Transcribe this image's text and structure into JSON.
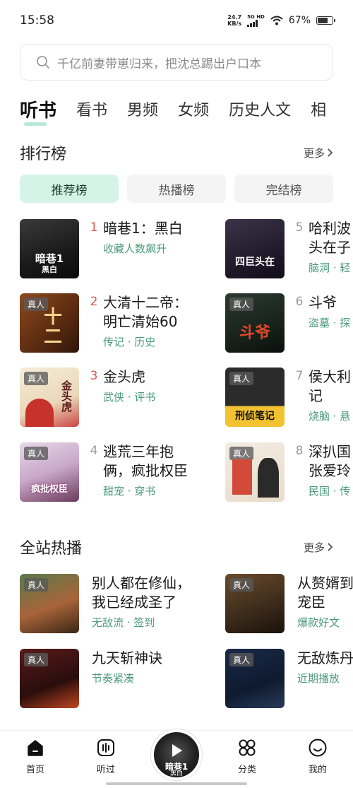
{
  "status_bar": {
    "time": "15:58",
    "net_speed": "24.7",
    "net_unit": "KB/s",
    "signal_label": "5G HD",
    "battery": "67%"
  },
  "search": {
    "placeholder": "千亿前妻带崽归来，把沈总踢出户口本"
  },
  "tabs": [
    {
      "label": "听书",
      "active": true
    },
    {
      "label": "看书"
    },
    {
      "label": "男频"
    },
    {
      "label": "女频"
    },
    {
      "label": "历史人文"
    },
    {
      "label": "相"
    }
  ],
  "ranking": {
    "title": "排行榜",
    "more": "更多",
    "sub_tabs": [
      "推荐榜",
      "热播榜",
      "完结榜"
    ],
    "items": [
      {
        "rank": "1",
        "title": "暗巷1：黑白",
        "subtitle": "收藏人数飙升",
        "cover_text": "暗巷1",
        "cover_sub": "黑白",
        "tag": ""
      },
      {
        "rank": "2",
        "title": "大清十二帝：明亡清始60",
        "line1": "大清十二帝：",
        "line2": "明亡清始60",
        "subtitle": "传记 · 历史",
        "tag": "真人"
      },
      {
        "rank": "3",
        "title": "金头虎",
        "subtitle": "武侠 · 评书",
        "tag": "真人"
      },
      {
        "rank": "4",
        "title": "逃荒三年抱俩，疯批权臣",
        "line1": "逃荒三年抱",
        "line2": "俩，疯批权臣",
        "subtitle": "甜宠 · 穿书",
        "tag": "真人"
      },
      {
        "rank": "5",
        "title": "哈利波特",
        "line1": "哈利波",
        "line2": "头在子",
        "subtitle": "脑洞 · 轻",
        "tag": ""
      },
      {
        "rank": "6",
        "title": "斗爷",
        "subtitle": "盗墓 · 探",
        "tag": "真人"
      },
      {
        "rank": "7",
        "title": "侯大利记",
        "line1": "侯大利",
        "line2": "记",
        "subtitle": "烧脑 · 悬",
        "tag": "真人"
      },
      {
        "rank": "8",
        "title": "深扒国张爱玲",
        "line1": "深扒国",
        "line2": "张爱玲",
        "subtitle": "民国 · 传",
        "tag": "真人"
      }
    ]
  },
  "hot": {
    "title": "全站热播",
    "more": "更多",
    "items": [
      {
        "line1": "别人都在修仙，",
        "line2": "我已经成圣了",
        "subtitle": "无敌流 · 签到",
        "tag": "真人"
      },
      {
        "line1": "从赘婿到",
        "line2": "宠臣",
        "subtitle": "爆款好文",
        "tag": "真人"
      },
      {
        "line1": "九天斩神诀",
        "line2": "",
        "subtitle": "节奏紧凑",
        "tag": "真人"
      },
      {
        "line1": "无敌炼丹",
        "line2": "",
        "subtitle": "近期播放",
        "tag": "真人"
      }
    ]
  },
  "bottom_nav": {
    "home": "首页",
    "history": "听过",
    "player_title": "暗巷1",
    "player_sub": "黑白",
    "category": "分类",
    "mine": "我的"
  },
  "colors": {
    "accent": "#4b9a7b",
    "rank_top": "#e05a4a",
    "active_sub_tab": "#d6f3e8"
  }
}
